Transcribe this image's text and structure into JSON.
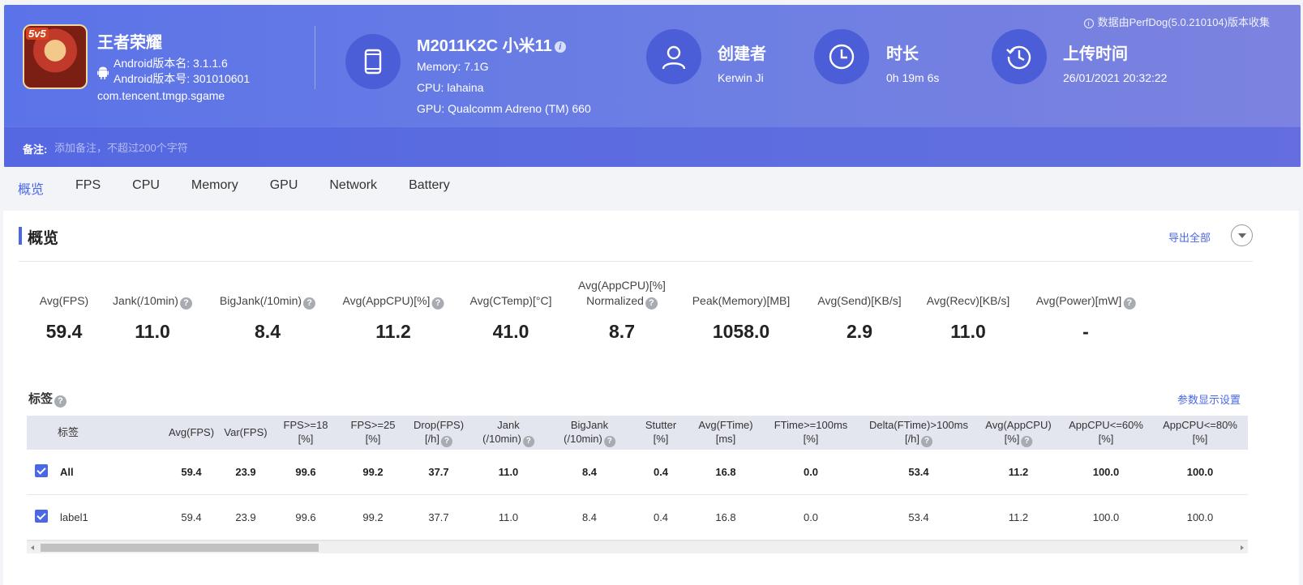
{
  "header": {
    "source_note": "数据由PerfDog(5.0.210104)版本收集",
    "app": {
      "icon_badge": "5v5",
      "name": "王者荣耀",
      "version_name": "Android版本名: 3.1.1.6",
      "version_code": "Android版本号: 301010601",
      "package": "com.tencent.tmgp.sgame"
    },
    "device": {
      "model": "M2011K2C 小米11",
      "memory": "Memory: 7.1G",
      "cpu": "CPU: lahaina",
      "gpu": "GPU: Qualcomm Adreno (TM) 660"
    },
    "creator": {
      "title": "创建者",
      "value": "Kerwin Ji"
    },
    "duration": {
      "title": "时长",
      "value": "0h 19m 6s"
    },
    "upload": {
      "title": "上传时间",
      "value": "26/01/2021 20:32:22"
    },
    "notes": {
      "label": "备注:",
      "placeholder": "添加备注，不超过200个字符"
    }
  },
  "tabs": [
    "概览",
    "FPS",
    "CPU",
    "Memory",
    "GPU",
    "Network",
    "Battery"
  ],
  "overview": {
    "title": "概览",
    "export_label": "导出全部",
    "metrics": [
      {
        "label": "Avg(FPS)",
        "value": "59.4"
      },
      {
        "label": "Jank(/10min)",
        "value": "11.0"
      },
      {
        "label": "BigJank(/10min)",
        "value": "8.4"
      },
      {
        "label": "Avg(AppCPU)[%]",
        "value": "11.2"
      },
      {
        "label": "Avg(CTemp)[°C]",
        "value": "41.0"
      },
      {
        "label": "Avg(AppCPU)[%]",
        "label2": "Normalized",
        "value": "8.7"
      },
      {
        "label": "Peak(Memory)[MB]",
        "value": "1058.0"
      },
      {
        "label": "Avg(Send)[KB/s]",
        "value": "2.9"
      },
      {
        "label": "Avg(Recv)[KB/s]",
        "value": "11.0"
      },
      {
        "label": "Avg(Power)[mW]",
        "value": "-"
      }
    ]
  },
  "tags": {
    "title": "标签",
    "param_settings_label": "参数显示设置",
    "columns": [
      {
        "l1": "标签"
      },
      {
        "l1": "Avg(FPS)"
      },
      {
        "l1": "Var(FPS)"
      },
      {
        "l1": "FPS>=18",
        "l2": "[%]"
      },
      {
        "l1": "FPS>=25",
        "l2": "[%]"
      },
      {
        "l1": "Drop(FPS)",
        "l2": "[/h]"
      },
      {
        "l1": "Jank",
        "l2": "(/10min)"
      },
      {
        "l1": "BigJank",
        "l2": "(/10min)"
      },
      {
        "l1": "Stutter",
        "l2": "[%]"
      },
      {
        "l1": "Avg(FTime)",
        "l2": "[ms]"
      },
      {
        "l1": "FTime>=100ms",
        "l2": "[%]"
      },
      {
        "l1": "Delta(FTime)>100ms",
        "l2": "[/h]"
      },
      {
        "l1": "Avg(AppCPU)",
        "l2": "[%]"
      },
      {
        "l1": "AppCPU<=60%",
        "l2": "[%]"
      },
      {
        "l1": "AppCPU<=80%",
        "l2": "[%]"
      }
    ],
    "rows": [
      {
        "label": "All",
        "values": [
          "59.4",
          "23.9",
          "99.6",
          "99.2",
          "37.7",
          "11.0",
          "8.4",
          "0.4",
          "16.8",
          "0.0",
          "53.4",
          "11.2",
          "100.0",
          "100.0"
        ]
      },
      {
        "label": "label1",
        "values": [
          "59.4",
          "23.9",
          "99.6",
          "99.2",
          "37.7",
          "11.0",
          "8.4",
          "0.4",
          "16.8",
          "0.0",
          "53.4",
          "11.2",
          "100.0",
          "100.0"
        ]
      }
    ]
  }
}
